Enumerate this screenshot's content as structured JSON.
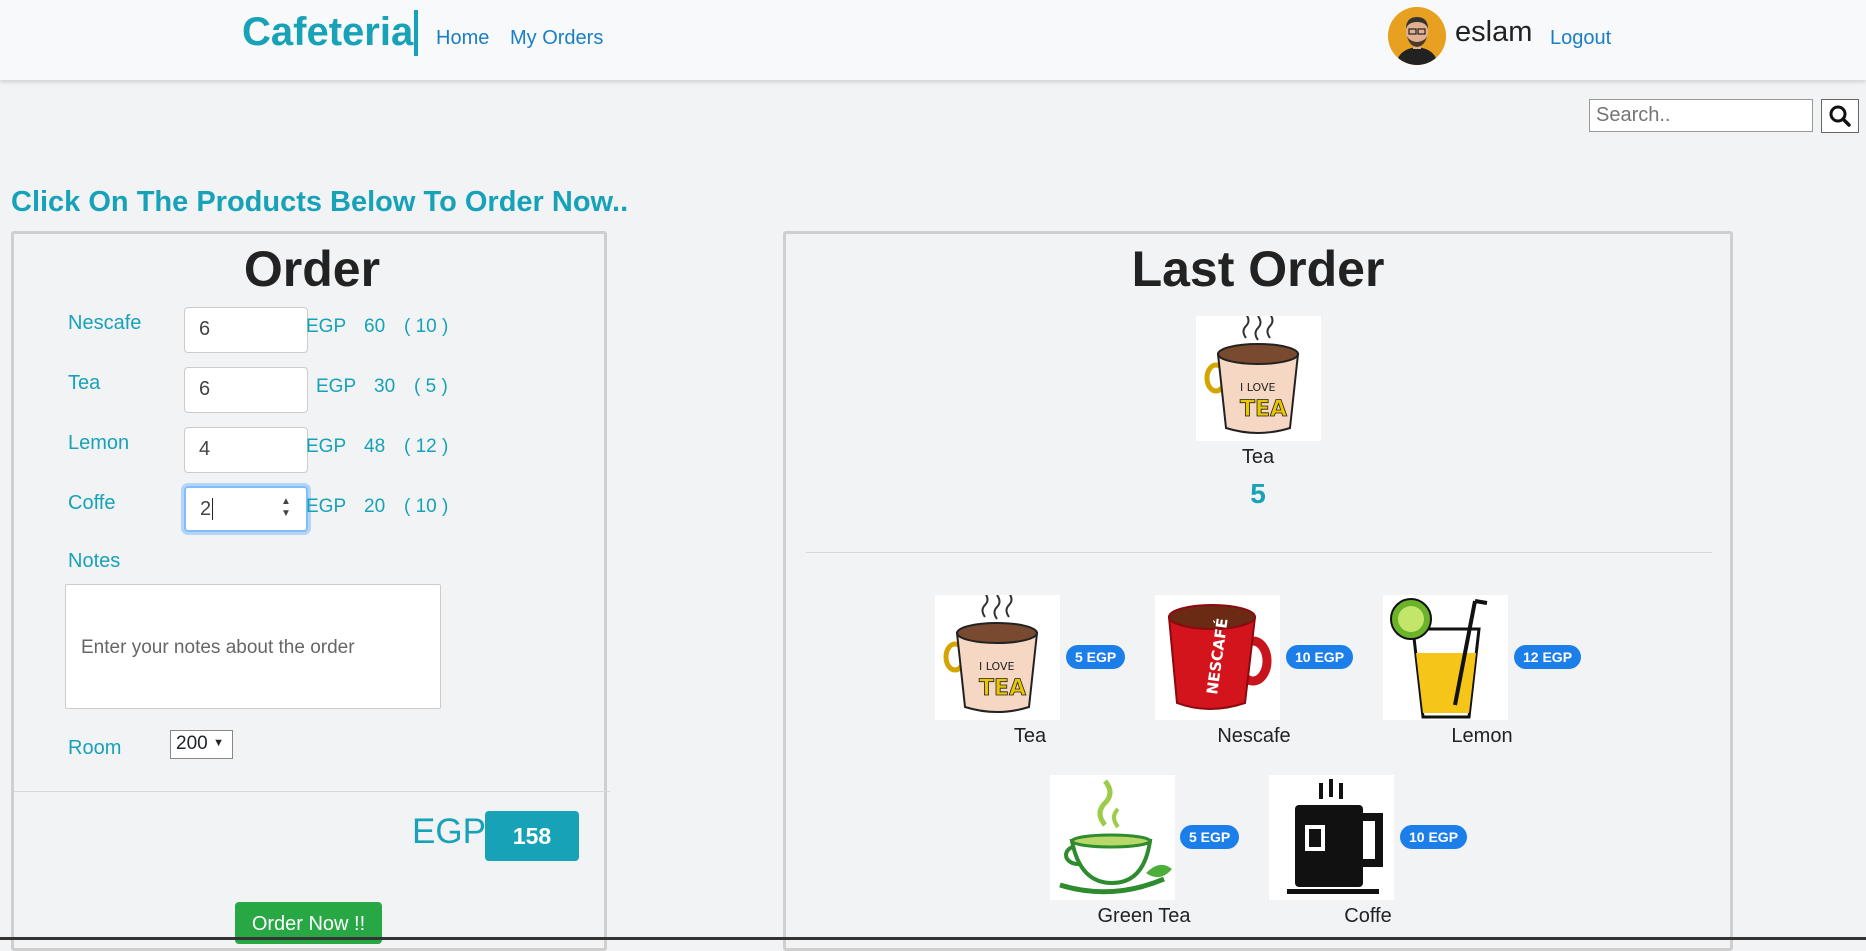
{
  "nav": {
    "brand": "Cafeteria",
    "home": "Home",
    "my_orders": "My Orders",
    "username": "eslam",
    "logout": "Logout"
  },
  "search": {
    "placeholder": "Search..",
    "icon": "search-icon"
  },
  "prompt": "Click On The Products Below To Order Now..",
  "order": {
    "title": "Order",
    "items": [
      {
        "name": "Nescafe",
        "qty": "6",
        "currency": "EGP",
        "total": "60",
        "unit": "( 10 )"
      },
      {
        "name": "Tea",
        "qty": "6",
        "currency": "EGP",
        "total": "30",
        "unit": "( 5 )"
      },
      {
        "name": "Lemon",
        "qty": "4",
        "currency": "EGP",
        "total": "48",
        "unit": "( 12 )"
      },
      {
        "name": "Coffe",
        "qty": "2",
        "currency": "EGP",
        "total": "20",
        "unit": "( 10 )"
      }
    ],
    "notes_label": "Notes",
    "notes_placeholder": "Enter your notes about the order",
    "room_label": "Room",
    "room_value": "200",
    "total_currency": "EGP",
    "total": "158",
    "submit": "Order Now !!"
  },
  "last_order": {
    "title": "Last Order",
    "item_name": "Tea",
    "item_qty": "5"
  },
  "products": [
    {
      "name": "Tea",
      "price": "5 EGP",
      "icon": "tea-mug-icon"
    },
    {
      "name": "Nescafe",
      "price": "10 EGP",
      "icon": "nescafe-mug-icon"
    },
    {
      "name": "Lemon",
      "price": "12 EGP",
      "icon": "lemon-drink-icon"
    },
    {
      "name": "Green Tea",
      "price": "5 EGP",
      "icon": "green-tea-icon"
    },
    {
      "name": "Coffe",
      "price": "10 EGP",
      "icon": "coffee-mug-icon"
    }
  ],
  "colors": {
    "accent": "#17a2b8",
    "link": "#1a7fc4",
    "badge": "#1c7ee8",
    "success": "#28a745"
  }
}
